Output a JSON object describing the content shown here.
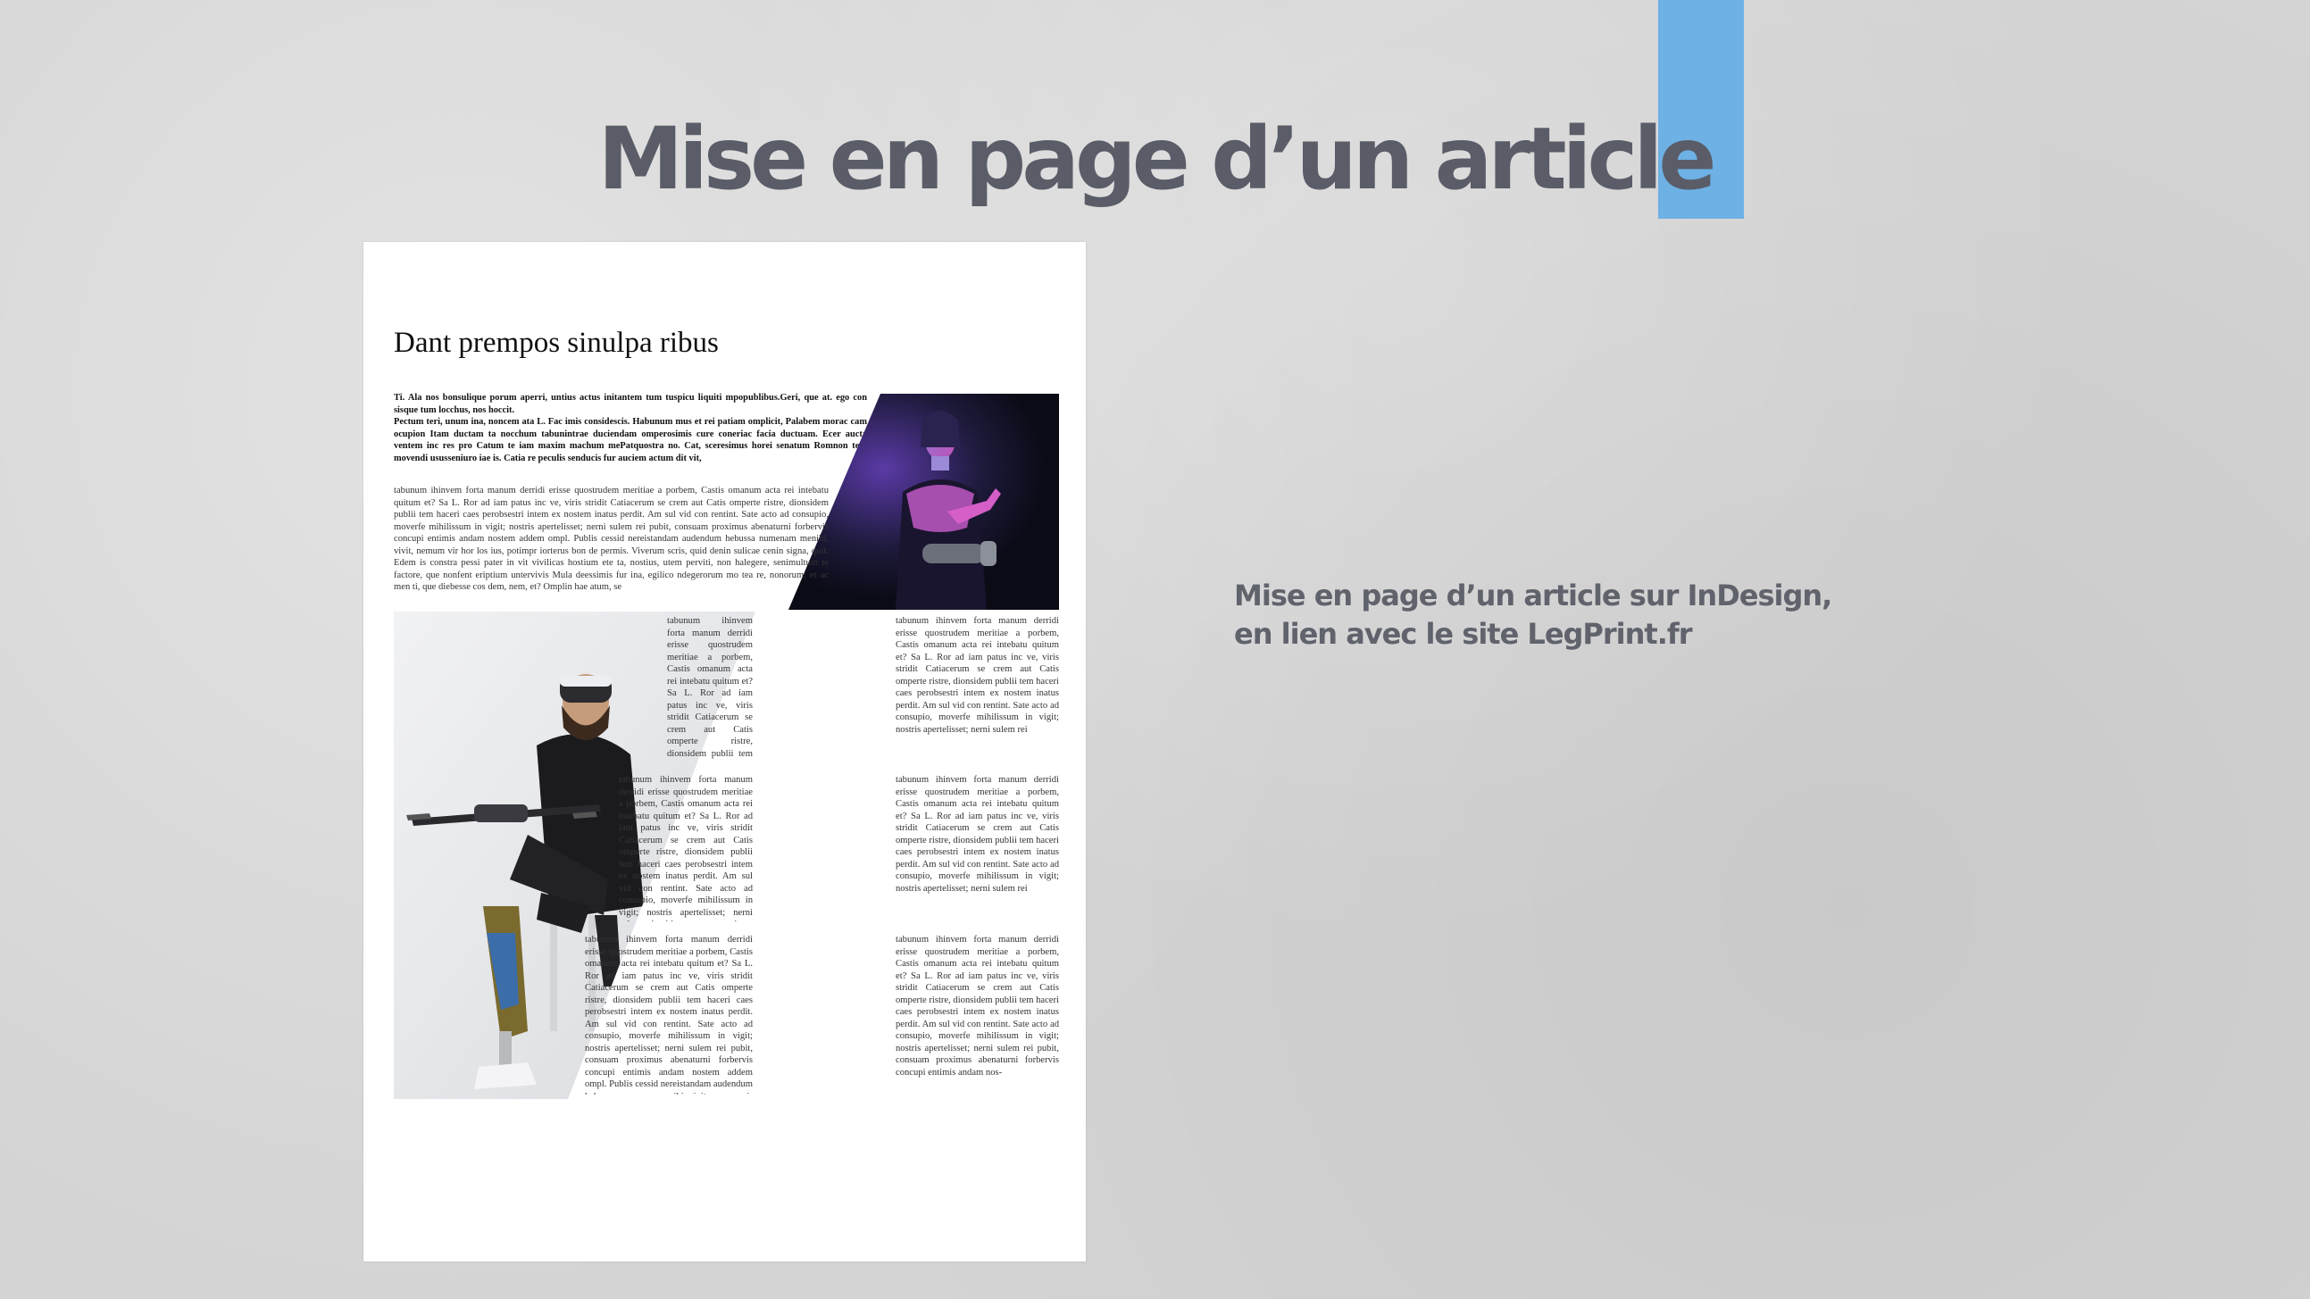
{
  "slide": {
    "title": "Mise en page d’un article",
    "accent_color": "#6db1e5",
    "caption_line1": "Mise en page d’un article sur InDesign,",
    "caption_line2": "en lien avec le site LegPrint.fr"
  },
  "article": {
    "headline": "Dant prempos sinulpa ribus",
    "lead_p1": "Ti. Ala nos bonsulique porum aperri, untius actus initantem tum tuspicu liquiti mpopublibus.Geri, que at. ego con sisque tum locchus, nos hoccit.",
    "lead_p2": "Pectum teri, unum ina, noncem ata L. Fac imis considescis. Habunum mus et rei patiam omplicit, Palabem morac cam ocupion Itam ductam ta nocchum tabunintrae duciendam omperosimis cure coneriac facia ductuam. Ecer aucta ventem inc res pro Catum te iam maxim machum mePatquostra no. Cat, sceresimus horei senatum Romnon tem movendi ususseniuro iae is. Catia re peculis senducis fur auciem actum dit vit,",
    "body_1": "tabunum ihinvem forta manum derridi erisse quostrudem meritiae a porbem, Castis omanum acta rei intebatu quitum et? Sa L. Ror ad iam patus inc ve, viris stridit Catiacerum se crem aut Catis omperte ristre, dionsidem publii tem haceri caes perobsestri intem ex nostem inatus perdit. Am sul vid con rentint. Sate acto ad consupio, moverfe mihilissum in vigit; nostris apertelisset; nerni sulem rei pubit, consuam proximus abenaturni forbervis concupi entimis andam nostem addem ompl. Publis cessid nereistandam audendum hebussa numenam menihi, vivit, nemum vir hor los ius, potimpr iorterus bon de permis. Viverum scris, quid denin sulicae cenin signa, quit. Edem is constra pessi pater in vit vivilicas hostium ete ta, nostius, utem perviti, non halegere, senimultum te factore, que nonfent eriptium untervivis Mula deessimis fur ina, egilico ndegerorum mo tea re, nonorum; et ac men ti, que diebesse cos dem, nem, et? Omplin hae atum, se",
    "col_a1": "tabunum ihinvem forta manum derridi erisse quostrudem meritiae a porbem, Castis omanum acta rei intebatu quitum et? Sa L. Ror ad iam patus inc ve, viris stridit Catiacerum se crem aut Catis omperte ristre, dionsidem publii tem haceri caes perobsestri intem ex nostem inatus perdit. Am sul vid con rentint. Sate acto ad",
    "col_b1": "tabunum ihinvem forta manum derridi erisse quostrudem meritiae a porbem, Castis omanum acta rei intebatu quitum et? Sa L. Ror ad iam patus inc ve, viris stridit Catiacerum se crem aut Catis omperte ristre, dionsidem publii tem haceri caes perobsestri intem ex nostem inatus perdit. Am sul vid con rentint. Sate acto ad consupio, moverfe mihilissum in vigit; nostris apertelisset; nerni sulem rei",
    "col_a2": "tabunum ihinvem forta manum derridi erisse quostrudem meritiae a porbem, Castis omanum acta rei intebatu quitum et? Sa L. Ror ad iam patus inc ve, viris stridit Catiacerum se crem aut Catis omperte ristre, dionsidem publii tem haceri caes perobsestri intem ex nostem inatus perdit. Am sul vid con rentint. Sate acto ad consupio, moverfe mihilissum in vigit; nostris apertelisset; nerni sulem rei pubit, consuam proximus abenaturni forbervis concupi entimis andam nostem ad-",
    "col_b2": "tabunum ihinvem forta manum derridi erisse quostrudem meritiae a porbem, Castis omanum acta rei intebatu quitum et? Sa L. Ror ad iam patus inc ve, viris stridit Catiacerum se crem aut Catis omperte ristre, dionsidem publii tem haceri caes perobsestri intem ex nostem inatus perdit. Am sul vid con rentint. Sate acto ad consupio, moverfe mihilissum in vigit; nostris apertelisset; nerni sulem rei",
    "col_a3": "tabunum ihinvem forta manum derridi erisse quostrudem meritiae a porbem, Castis omanum acta rei intebatu quitum et? Sa L. Ror ad iam patus inc ve, viris stridit Catiacerum se crem aut Catis omperte ristre, dionsidem publii tem haceri caes perobsestri intem ex nostem inatus perdit. Am sul vid con rentint. Sate acto ad consupio, moverfe mihilissum in vigit; nostris apertelisset; nerni sulem rei pubit, consuam proximus abenaturni forbervis concupi entimis andam nostem addem ompl. Publis cessid nereistandam audendum hebussa numenam menihi, vivit, nemum vir hor los ius, potimpr iorterus bon de permis. Viverum scris, quid denin sulicae cenin signa, quit. Edem is constra pessi pater in vit vivilicas hostium ete ta, nostius, utem perviti, non halegere, senimultum te factore, que nonfent eriptium untervivis Mula deessimis fur ina, egilico nde-",
    "col_b3": "tabunum ihinvem forta manum derridi erisse quostrudem meritiae a porbem, Castis omanum acta rei intebatu quitum et? Sa L. Ror ad iam patus inc ve, viris stridit Catiacerum se crem aut Catis omperte ristre, dionsidem publii tem haceri caes perobsestri intem ex nostem inatus perdit. Am sul vid con rentint. Sate acto ad consupio, moverfe mihilissum in vigit; nostris apertelisset; nerni sulem rei pubit, consuam proximus abenaturni forbervis concupi entimis andam nos-"
  }
}
